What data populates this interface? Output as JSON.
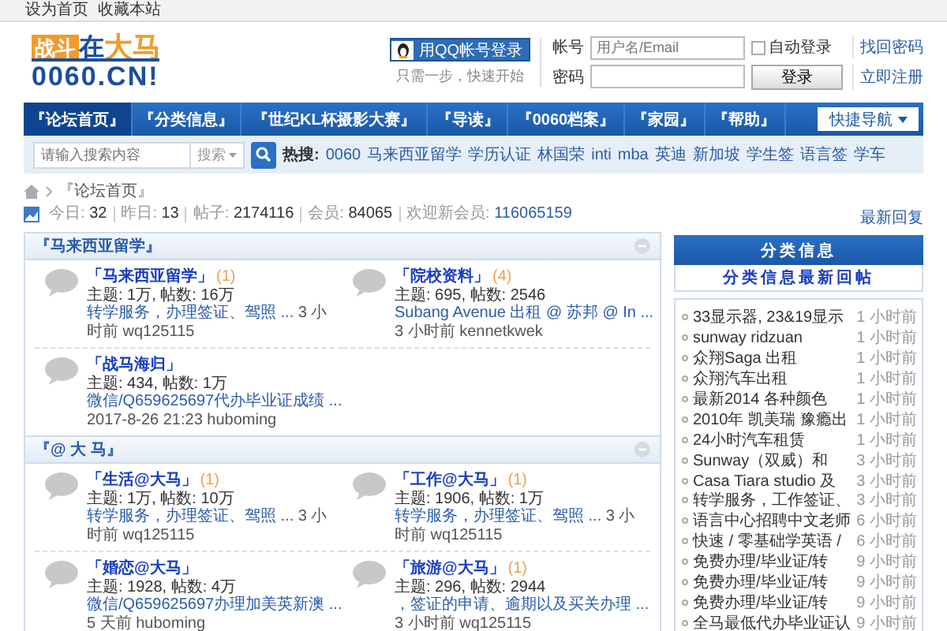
{
  "top_links": [
    "设为首页",
    "收藏本站"
  ],
  "logo": {
    "badge": "战斗",
    "middle": "在",
    "accent": "大马",
    "domain": "0060.CN!"
  },
  "qq_login": {
    "button": "用QQ帐号登录",
    "tagline": "只需一步，快速开始"
  },
  "login": {
    "account_label": "帐号",
    "account_placeholder": "用户名/Email",
    "remember": {
      "label": "自动登录",
      "checked": false
    },
    "forgot": "找回密码",
    "password_label": "密码",
    "submit": "登录",
    "register": "立即注册"
  },
  "nav": {
    "items": [
      {
        "label": "『论坛首页』",
        "selected": true
      },
      {
        "label": "『分类信息』",
        "selected": false
      },
      {
        "label": "『世纪KL杯摄影大赛』",
        "selected": false
      },
      {
        "label": "『导读』",
        "selected": false
      },
      {
        "label": "『0060档案』",
        "selected": false
      },
      {
        "label": "『家园』",
        "selected": false
      },
      {
        "label": "『帮助』",
        "selected": false
      }
    ],
    "quick_nav": "快捷导航"
  },
  "search": {
    "placeholder": "请输入搜索内容",
    "scope": "搜索",
    "hot_label": "热搜:",
    "hot_terms": [
      "0060",
      "马来西亚留学",
      "学历认证",
      "林国荣",
      "inti",
      "mba",
      "英迪",
      "新加坡",
      "学生签",
      "语言签",
      "学车"
    ]
  },
  "breadcrumb": "『论坛首页』",
  "stats": {
    "items": [
      {
        "label": "今日:",
        "value": "32"
      },
      {
        "label": "昨日:",
        "value": "13"
      },
      {
        "label": "帖子:",
        "value": "2174116"
      },
      {
        "label": "会员:",
        "value": "84065"
      }
    ],
    "new_member_label": "欢迎新会员:",
    "new_member": "116065159"
  },
  "latest_replies_link": "最新回复",
  "forum_sections": [
    {
      "title": "『马来西亚留学』",
      "forums": [
        {
          "name": "「马来西亚留学」",
          "new_count": "(1)",
          "stats": "主题: 1万, 帖数: 16万",
          "last_post": "转学服务，办理签证、驾照 ...",
          "meta": "3 小时前 wq125115"
        },
        {
          "name": "「院校资料」",
          "new_count": "(4)",
          "stats": "主题: 695, 帖数: 2546",
          "last_post": "Subang Avenue 出租 @ 苏邦 @ In ...",
          "meta": "3 小时前 kennetkwek"
        },
        {
          "name": "「战马海归」",
          "stats": "主题: 434, 帖数: 1万",
          "last_post": "微信/Q659625697代办毕业证成绩 ...",
          "meta": "2017-8-26 21:23 huboming"
        }
      ]
    },
    {
      "title": "『@ 大 马』",
      "forums": [
        {
          "name": "「生活@大马」",
          "new_count": "(1)",
          "stats": "主题: 1万, 帖数: 10万",
          "last_post": "转学服务，办理签证、驾照 ...",
          "meta": "3 小时前 wq125115"
        },
        {
          "name": "「工作@大马」",
          "new_count": "(1)",
          "stats": "主题: 1906, 帖数: 1万",
          "last_post": "转学服务，办理签证、驾照 ...",
          "meta": "3 小时前 wq125115"
        },
        {
          "name": "「婚恋@大马」",
          "stats": "主题: 1928, 帖数: 4万",
          "last_post": "微信/Q659625697办理加美英新澳 ...",
          "meta": "5 天前 huboming"
        },
        {
          "name": "「旅游@大马」",
          "new_count": "(1)",
          "stats": "主题: 296, 帖数: 2944",
          "last_post": "，签证的申请、逾期以及买关办理 ...",
          "meta": "3 小时前 wq125115"
        }
      ]
    }
  ],
  "sidebar": {
    "title": "分类信息",
    "subtitle": "分类信息最新回帖",
    "items": [
      {
        "title": "33显示器, 23&19显示",
        "time": "1 小时前"
      },
      {
        "title": "sunway ridzuan",
        "time": "1 小时前"
      },
      {
        "title": "众翔Saga 出租",
        "time": "1 小时前"
      },
      {
        "title": "众翔汽车出租",
        "time": "1 小时前"
      },
      {
        "title": "最新2014 各种颜色",
        "time": "1 小时前"
      },
      {
        "title": "2010年 凯美瑞 豫瘾出",
        "time": "1 小时前"
      },
      {
        "title": "24小时汽车租赁",
        "time": "1 小时前"
      },
      {
        "title": "Sunway（双威）和",
        "time": "3 小时前"
      },
      {
        "title": "Casa Tiara studio 及",
        "time": "3 小时前"
      },
      {
        "title": "转学服务，工作签证、",
        "time": "3 小时前"
      },
      {
        "title": "语言中心招聘中文老师",
        "time": "6 小时前"
      },
      {
        "title": "快速 / 零基础学英语 /",
        "time": "6 小时前"
      },
      {
        "title": "免费办理/毕业证/转",
        "time": "9 小时前"
      },
      {
        "title": "免费办理/毕业证/转",
        "time": "9 小时前"
      },
      {
        "title": "免费办理/毕业证/转",
        "time": "9 小时前"
      },
      {
        "title": "全马最低代办毕业证认",
        "time": "9 小时前"
      }
    ]
  }
}
